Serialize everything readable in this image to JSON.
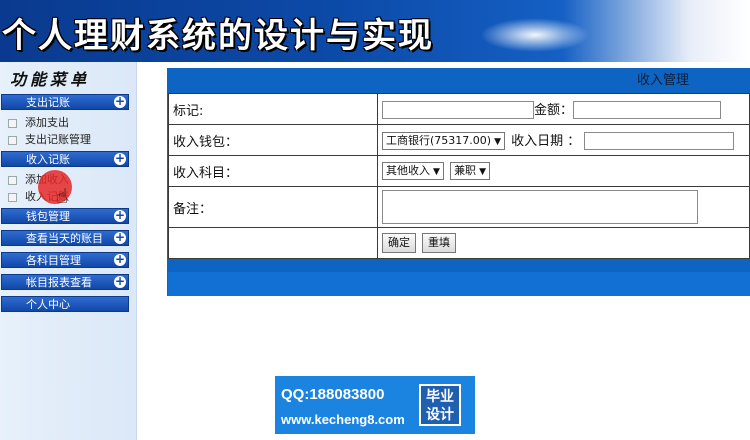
{
  "banner": {
    "title": "个人理财系统的设计与实现"
  },
  "sidebar": {
    "title": "功能菜单",
    "groups": [
      {
        "label": "支出记账",
        "items": [
          "添加支出",
          "支出记账管理"
        ]
      },
      {
        "label": "收入记账",
        "items": [
          "添加收入",
          "收入记账"
        ]
      },
      {
        "label": "钱包管理"
      },
      {
        "label": "查看当天的账目"
      },
      {
        "label": "各科目管理"
      },
      {
        "label": "帐目报表查看"
      },
      {
        "label": "个人中心"
      }
    ]
  },
  "form": {
    "header": "收入管理",
    "remark_label": "标记:",
    "remark_value": "",
    "amount_label": "金额：",
    "amount_value": "",
    "wallet_label": "收入钱包：",
    "wallet_selected": "工商银行(75317.00)",
    "date_label": "收入日期 ：",
    "date_value": "",
    "subject_label": "收入科目：",
    "subject_selected": "其他收入",
    "subject2_selected": "兼职",
    "note_label": "备注：",
    "note_value": "",
    "confirm_label": "确定",
    "reset_label": "重填"
  },
  "watermark": {
    "qq": "QQ:188083800",
    "url": "www.kecheng8.com",
    "badge_line1": "毕业",
    "badge_line2": "设计"
  },
  "colors": {
    "banner": "#0c4aa8",
    "panel": "#0e64c2",
    "menu_header": "#1148a8",
    "watermark": "#1a84e0"
  }
}
